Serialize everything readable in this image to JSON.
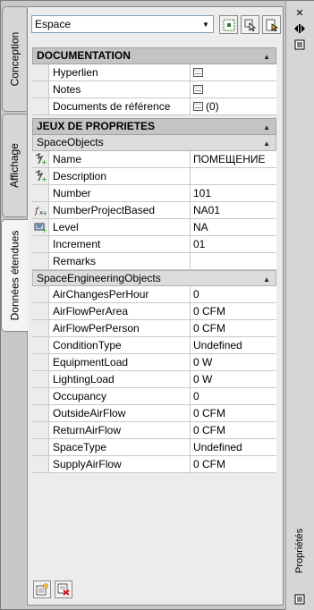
{
  "tabs": [
    {
      "label": "Conception"
    },
    {
      "label": "Affichage"
    },
    {
      "label": "Données étendues"
    }
  ],
  "toolbar": {
    "style_value": "Espace"
  },
  "documentation": {
    "title": "DOCUMENTATION",
    "rows": [
      {
        "name": "Hyperlien",
        "value": ""
      },
      {
        "name": "Notes",
        "value": ""
      },
      {
        "name": "Documents de référence",
        "value": "(0)"
      }
    ]
  },
  "property_sets": {
    "title": "JEUX DE PROPRIETES",
    "space_objects": {
      "title": "SpaceObjects",
      "rows": [
        {
          "name": "Name",
          "value": "ПОМЕЩЕНИЕ"
        },
        {
          "name": "Description",
          "value": ""
        },
        {
          "name": "Number",
          "value": "101"
        },
        {
          "name": "NumberProjectBased",
          "value": "NA01"
        },
        {
          "name": "Level",
          "value": "NA"
        },
        {
          "name": "Increment",
          "value": "01"
        },
        {
          "name": "Remarks",
          "value": ""
        }
      ]
    },
    "space_engineering": {
      "title": "SpaceEngineeringObjects",
      "rows": [
        {
          "name": "AirChangesPerHour",
          "value": "0"
        },
        {
          "name": "AirFlowPerArea",
          "value": "0 CFM"
        },
        {
          "name": "AirFlowPerPerson",
          "value": "0 CFM"
        },
        {
          "name": "ConditionType",
          "value": "Undefined"
        },
        {
          "name": "EquipmentLoad",
          "value": "0 W"
        },
        {
          "name": "LightingLoad",
          "value": "0 W"
        },
        {
          "name": "Occupancy",
          "value": "0"
        },
        {
          "name": "OutsideAirFlow",
          "value": "0 CFM"
        },
        {
          "name": "ReturnAirFlow",
          "value": "0 CFM"
        },
        {
          "name": "SpaceType",
          "value": "Undefined"
        },
        {
          "name": "SupplyAirFlow",
          "value": "0 CFM"
        }
      ]
    }
  },
  "right_panel": {
    "label": "Propriétés"
  }
}
